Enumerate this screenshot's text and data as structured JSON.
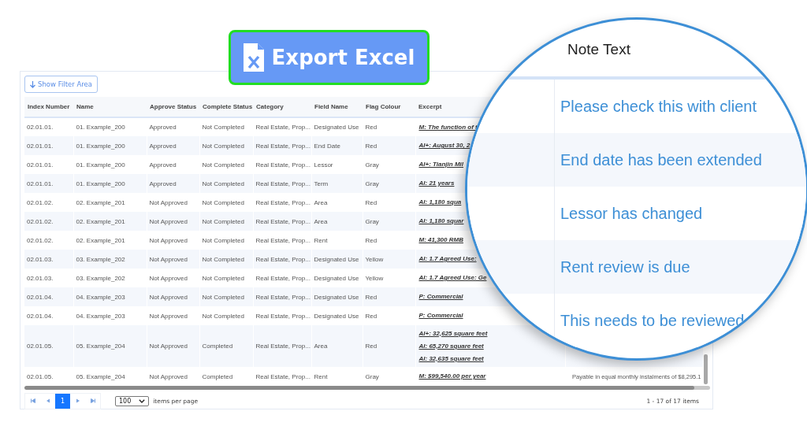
{
  "export_button": {
    "label": "Export Excel"
  },
  "filter_button": {
    "label": "Show Filter Area"
  },
  "table": {
    "columns": [
      "Index Number",
      "Name",
      "Approve Status",
      "Complete Status",
      "Category",
      "Field Name",
      "Flag Colour",
      "Excerpt"
    ],
    "rows": [
      {
        "cells": [
          "02.01.01.",
          "01. Example_200",
          "Approved",
          "Not Completed",
          "Real Estate, Prop...",
          "Designated Use",
          "Red"
        ],
        "excerpt": [
          "M: The function of t"
        ]
      },
      {
        "cells": [
          "02.01.01.",
          "01. Example_200",
          "Approved",
          "Not Completed",
          "Real Estate, Prop...",
          "End Date",
          "Red"
        ],
        "excerpt": [
          "AI+: August 30, 2"
        ]
      },
      {
        "cells": [
          "02.01.01.",
          "01. Example_200",
          "Approved",
          "Not Completed",
          "Real Estate, Prop...",
          "Lessor",
          "Gray"
        ],
        "excerpt": [
          "AI+: Tianjin Mil"
        ]
      },
      {
        "cells": [
          "02.01.01.",
          "01. Example_200",
          "Approved",
          "Not Completed",
          "Real Estate, Prop...",
          "Term",
          "Gray"
        ],
        "excerpt": [
          "AI: 21 years"
        ]
      },
      {
        "cells": [
          "02.01.02.",
          "02. Example_201",
          "Not Approved",
          "Not Completed",
          "Real Estate, Prop...",
          "Area",
          "Red"
        ],
        "excerpt": [
          "AI: 1,180 squa"
        ]
      },
      {
        "cells": [
          "02.01.02.",
          "02. Example_201",
          "Not Approved",
          "Not Completed",
          "Real Estate, Prop...",
          "Area",
          "Gray"
        ],
        "excerpt": [
          "AI: 1,180 squar"
        ]
      },
      {
        "cells": [
          "02.01.02.",
          "02. Example_201",
          "Not Approved",
          "Not Completed",
          "Real Estate, Prop...",
          "Rent",
          "Red"
        ],
        "excerpt": [
          "M: 41,300 RMB"
        ]
      },
      {
        "cells": [
          "02.01.03.",
          "03. Example_202",
          "Not Approved",
          "Not Completed",
          "Real Estate, Prop...",
          "Designated Use",
          "Yellow"
        ],
        "excerpt": [
          "AI: 1.7 Agreed Use:"
        ]
      },
      {
        "cells": [
          "02.01.03.",
          "03. Example_202",
          "Not Approved",
          "Not Completed",
          "Real Estate, Prop...",
          "Designated Use",
          "Yellow"
        ],
        "excerpt": [
          "AI: 1.7 Agreed Use: Ge"
        ]
      },
      {
        "cells": [
          "02.01.04.",
          "04. Example_203",
          "Not Approved",
          "Not Completed",
          "Real Estate, Prop...",
          "Designated Use",
          "Red"
        ],
        "excerpt": [
          "P: Commercial"
        ]
      },
      {
        "cells": [
          "02.01.04.",
          "04. Example_203",
          "Not Approved",
          "Not Completed",
          "Real Estate, Prop...",
          "Designated Use",
          "Red"
        ],
        "excerpt": [
          "P: Commercial"
        ]
      },
      {
        "cells": [
          "02.01.05.",
          "05. Example_204",
          "Not Approved",
          "Completed",
          "Real Estate, Prop...",
          "Area",
          "Red"
        ],
        "excerpt": [
          "AI+: 32,625 square feet",
          "AI: 65,270 square feet",
          "AI: 32,635 square feet"
        ]
      },
      {
        "cells": [
          "02.01.05.",
          "05. Example_204",
          "Not Approved",
          "Completed",
          "Real Estate, Prop...",
          "Rent",
          "Gray"
        ],
        "excerpt": [
          "M: $99,540.00 per year"
        ],
        "note": "Payable in equal monthly instalments of $8,295.1"
      }
    ]
  },
  "pager": {
    "pages": [
      {
        "label": "1",
        "selected": true
      }
    ],
    "page_size": "100",
    "page_size_label": "items per page",
    "summary": "1 - 17 of 17 items"
  },
  "magnifier": {
    "header": "Note Text",
    "notes": [
      "Please check this with client",
      "End date has been extended",
      "Lessor has changed",
      "Rent review is due",
      "This needs to be reviewed"
    ]
  }
}
